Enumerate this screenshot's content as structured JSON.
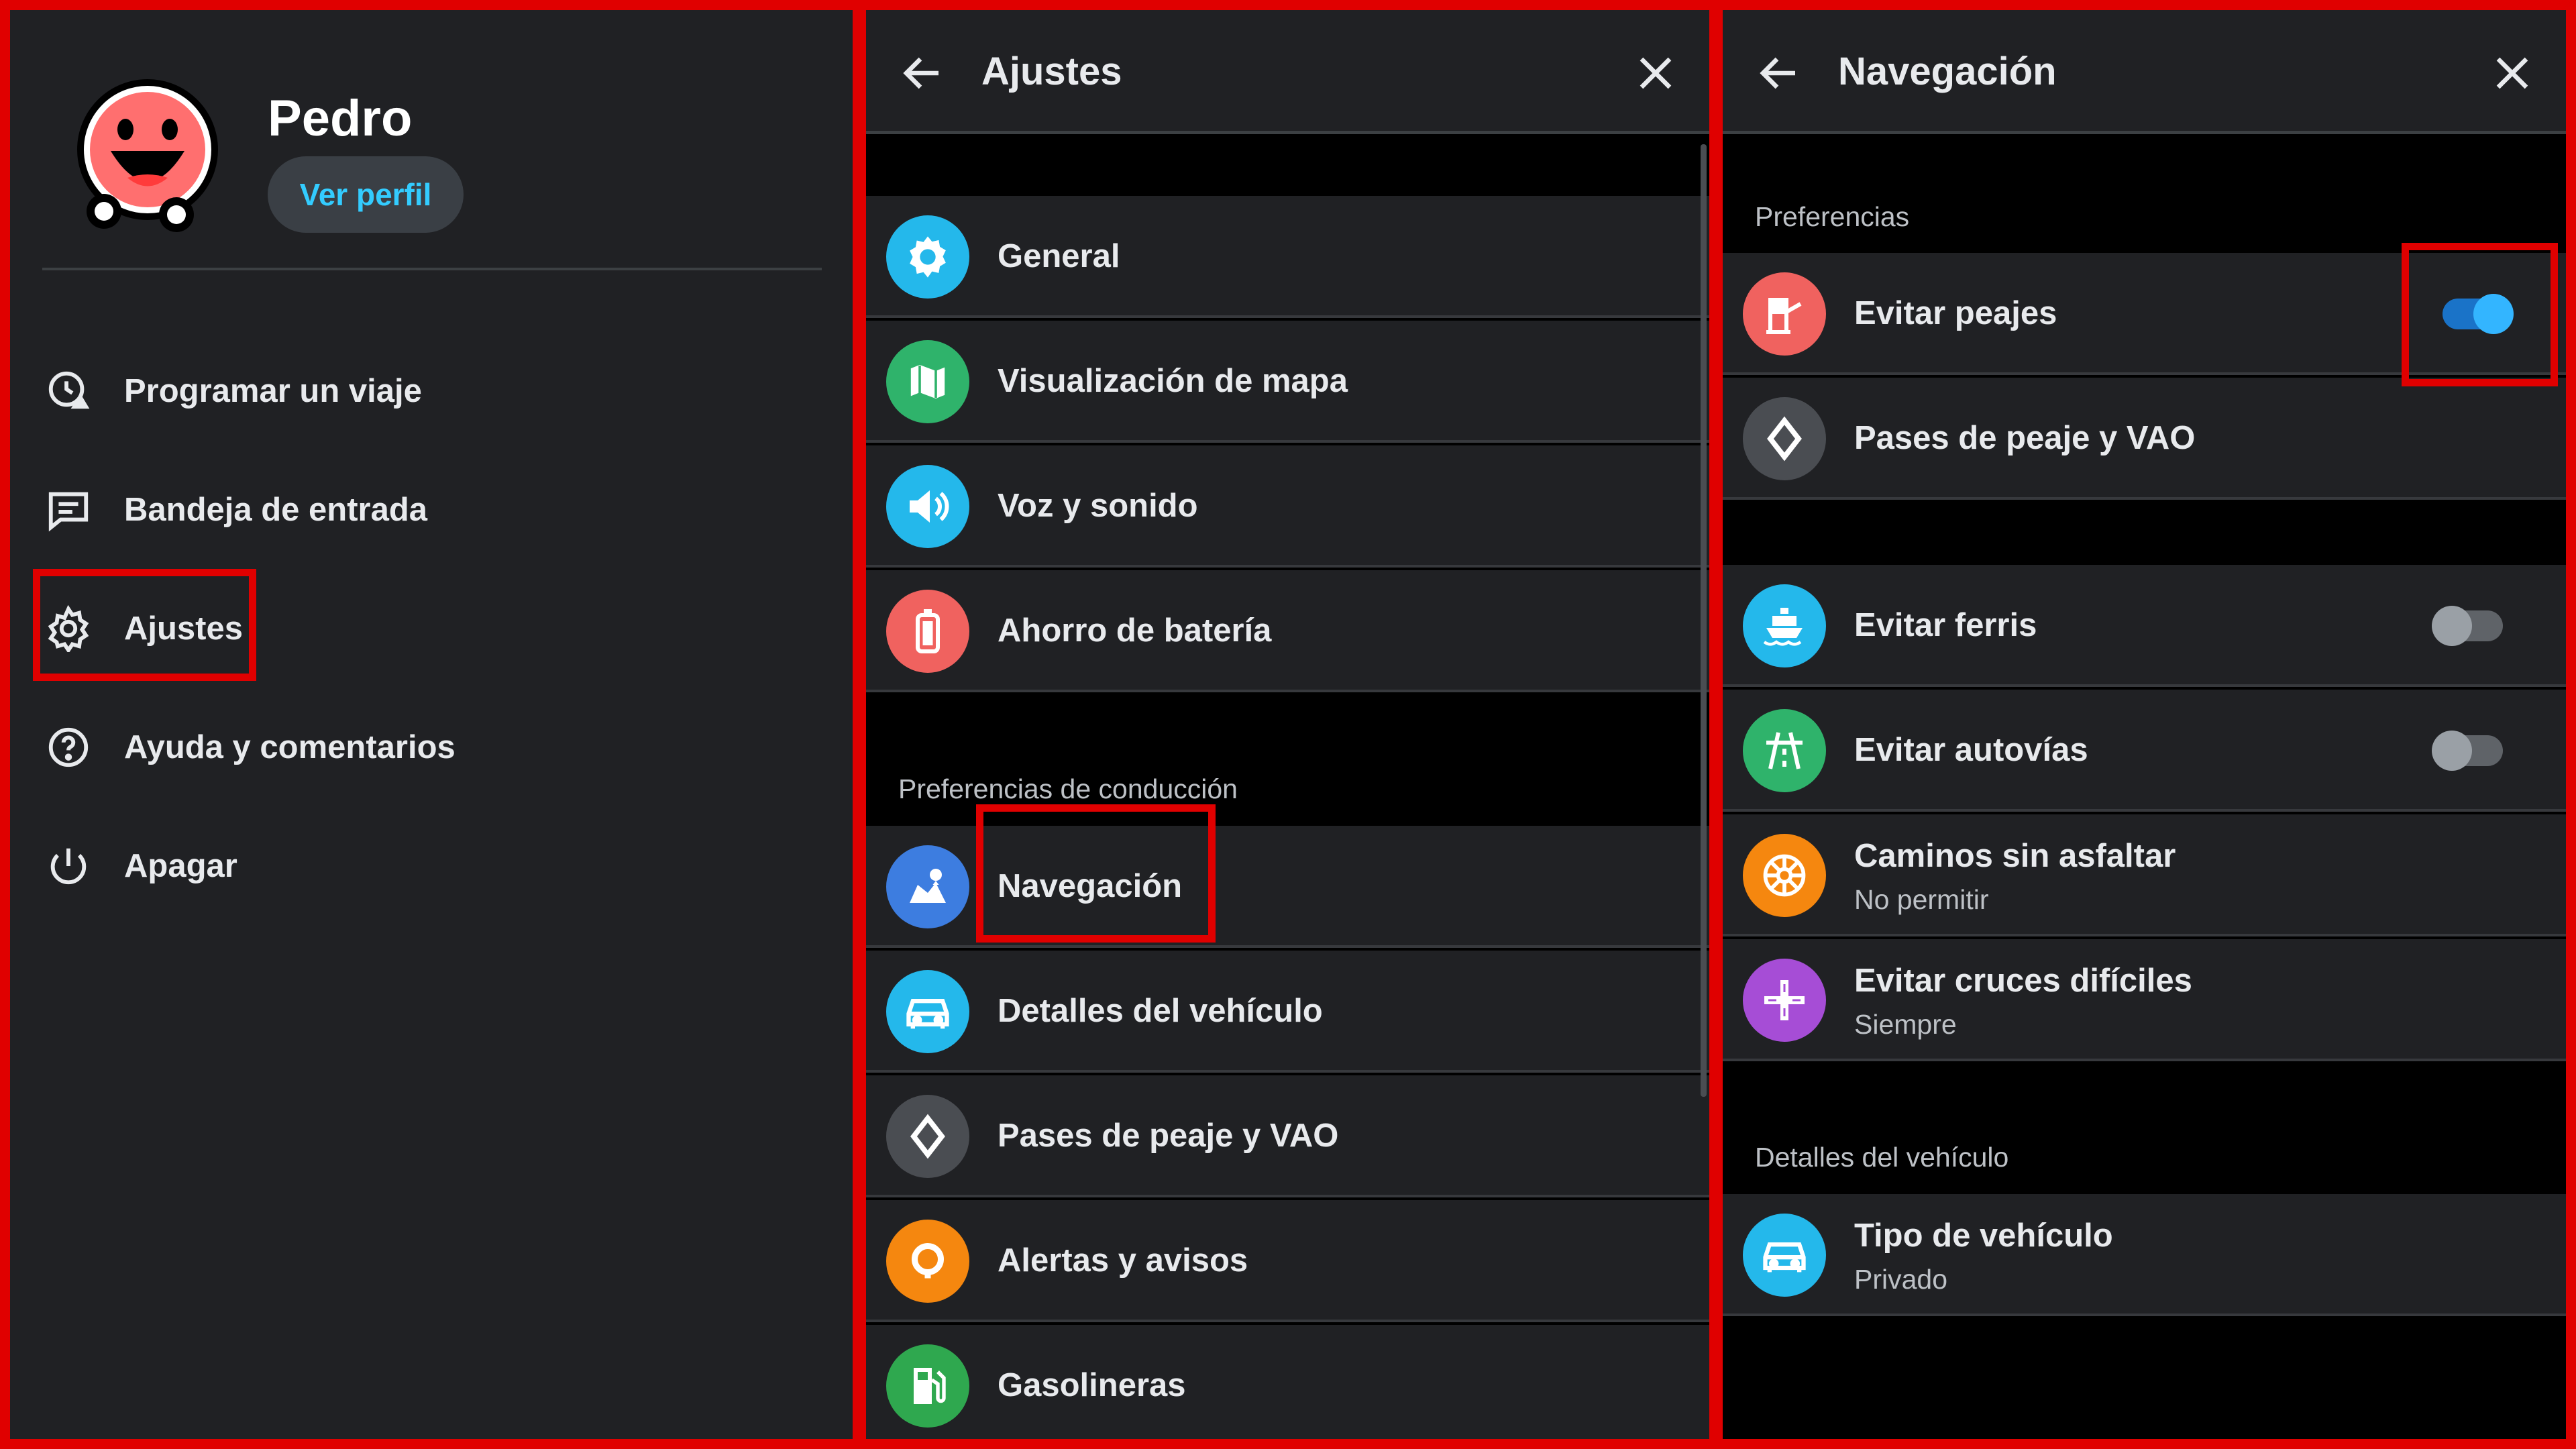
{
  "sidebar": {
    "user_name": "Pedro",
    "profile_button": "Ver perfil",
    "items": [
      {
        "label": "Programar un viaje",
        "icon": "schedule-trip-icon"
      },
      {
        "label": "Bandeja de entrada",
        "icon": "inbox-icon"
      },
      {
        "label": "Ajustes",
        "icon": "gear-icon"
      },
      {
        "label": "Ayuda y comentarios",
        "icon": "help-icon"
      },
      {
        "label": "Apagar",
        "icon": "power-icon"
      }
    ],
    "highlighted": "Ajustes"
  },
  "settings": {
    "title": "Ajustes",
    "items": [
      {
        "label": "General",
        "icon": "gear-icon",
        "color": "#24b8eb"
      },
      {
        "label": "Visualización de mapa",
        "icon": "map-icon",
        "color": "#2fb36b"
      },
      {
        "label": "Voz y sonido",
        "icon": "speaker-icon",
        "color": "#24b8eb"
      },
      {
        "label": "Ahorro de batería",
        "icon": "battery-icon",
        "color": "#f0625f"
      }
    ],
    "section_label": "Preferencias de conducción",
    "driving_items": [
      {
        "label": "Navegación",
        "icon": "navigation-icon",
        "color": "#3d7de0"
      },
      {
        "label": "Detalles del vehículo",
        "icon": "car-icon",
        "color": "#24b8eb"
      },
      {
        "label": "Pases de peaje y VAO",
        "icon": "diamond-icon",
        "color": "#4a4d52"
      },
      {
        "label": "Alertas y avisos",
        "icon": "alert-icon",
        "color": "#f5870f"
      },
      {
        "label": "Gasolineras",
        "icon": "fuel-icon",
        "color": "#2fa84f"
      }
    ],
    "highlighted": "Navegación"
  },
  "navigation": {
    "title": "Navegación",
    "section_preferences": "Preferencias",
    "avoid_tolls": {
      "label": "Evitar peajes",
      "enabled": true,
      "color": "#f0625f"
    },
    "toll_passes": {
      "label": "Pases de peaje y VAO",
      "color": "#4a4d52"
    },
    "avoid_ferries": {
      "label": "Evitar ferris",
      "enabled": false,
      "color": "#24b8eb"
    },
    "avoid_highways": {
      "label": "Evitar autovías",
      "enabled": false,
      "color": "#2fb36b"
    },
    "unpaved_roads": {
      "label": "Caminos sin asfaltar",
      "value": "No permitir",
      "color": "#f5870f"
    },
    "difficult_crossings": {
      "label": "Evitar cruces difíciles",
      "value": "Siempre",
      "color": "#a64dd6"
    },
    "section_vehicle": "Detalles del vehículo",
    "vehicle_type": {
      "label": "Tipo de vehículo",
      "value": "Privado",
      "color": "#24b8eb"
    }
  },
  "colors": {
    "highlight": "#e00000",
    "accent": "#33ccff",
    "toggle_on": "#1a73c8"
  }
}
